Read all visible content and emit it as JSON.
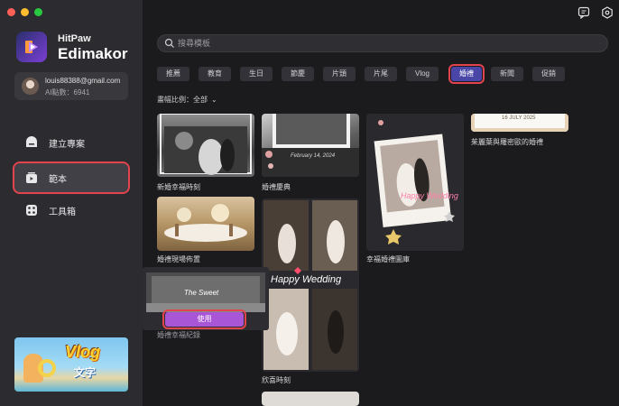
{
  "window": {
    "traffic_colors": [
      "#ff5f57",
      "#febc2e",
      "#28c840"
    ]
  },
  "sidebar": {
    "brand_line1": "HitPaw",
    "brand_line2": "Edimakor",
    "user": {
      "email": "louis88388@gmail.com",
      "points": "AI點數：6941"
    },
    "nav": [
      {
        "label": "建立專案",
        "icon": "home-icon"
      },
      {
        "label": "範本",
        "icon": "template-icon",
        "active": true
      },
      {
        "label": "工具箱",
        "icon": "toolbox-icon"
      }
    ],
    "promo": {
      "title": "Vlog",
      "subtitle": "文字"
    }
  },
  "header": {
    "icons": [
      "message-icon",
      "settings-icon"
    ]
  },
  "search": {
    "placeholder": "搜尋模板"
  },
  "categories": [
    "推薦",
    "教育",
    "生日",
    "節慶",
    "片頭",
    "片尾",
    "Vlog",
    "婚禮",
    "新聞",
    "促銷"
  ],
  "active_category": "婚禮",
  "ratio_filter": "畫幅比例：全部",
  "templates": [
    {
      "name": "新婚幸福時刻"
    },
    {
      "name": "婚禮慶典"
    },
    {
      "name": "婚禮現場佈置"
    },
    {
      "name": "幸福婚禮圖庫"
    },
    {
      "name": "茱麗葉與羅密歐的婚禮"
    },
    {
      "name": "欣喜時刻"
    },
    {
      "name": "婚禮幸福紀錄"
    }
  ],
  "overlay_texts": {
    "card2_date": "February 14, 2024",
    "card5_date": "16 JULY 2025",
    "card6_text": "Happy Wedding",
    "card3_text": "Happy Wedding",
    "hover_text": "The Sweet"
  },
  "use_button": "使用",
  "accent": "#4a46a8",
  "highlight": "#e2444d"
}
